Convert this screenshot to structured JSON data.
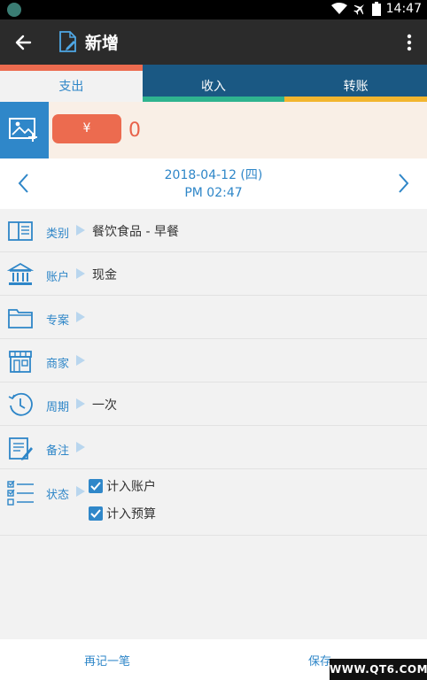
{
  "status_bar": {
    "time": "14:47"
  },
  "app_bar": {
    "title": "新增"
  },
  "tabs": [
    {
      "label": "支出",
      "active": true,
      "top_color": "#ec6b4f"
    },
    {
      "label": "收入",
      "active": false,
      "bottom_color": "#2fb38f"
    },
    {
      "label": "转账",
      "active": false,
      "bottom_color": "#f2b52e"
    }
  ],
  "amount": {
    "currency": "¥",
    "value": "0"
  },
  "date": {
    "line1": "2018-04-12 (四)",
    "line2": "PM 02:47"
  },
  "fields": [
    {
      "label": "类别",
      "value": "餐饮食品 - 早餐",
      "icon": "book-icon"
    },
    {
      "label": "账户",
      "value": "现金",
      "icon": "bank-icon"
    },
    {
      "label": "专案",
      "value": "",
      "icon": "folder-icon"
    },
    {
      "label": "商家",
      "value": "",
      "icon": "store-icon"
    },
    {
      "label": "周期",
      "value": "一次",
      "icon": "clock-icon"
    },
    {
      "label": "备注",
      "value": "",
      "icon": "note-icon"
    }
  ],
  "status": {
    "label": "状态",
    "options": [
      {
        "label": "计入账户",
        "checked": true
      },
      {
        "label": "计入预算",
        "checked": true
      }
    ]
  },
  "bottom": {
    "again": "再记一笔",
    "save": "保存"
  },
  "watermark": "WWW.QT6.COM",
  "colors": {
    "accent_blue": "#2e86c8",
    "appbar": "#2b2b2b",
    "tab_bg": "#1a5883",
    "amount_red": "#ec6b4f"
  }
}
